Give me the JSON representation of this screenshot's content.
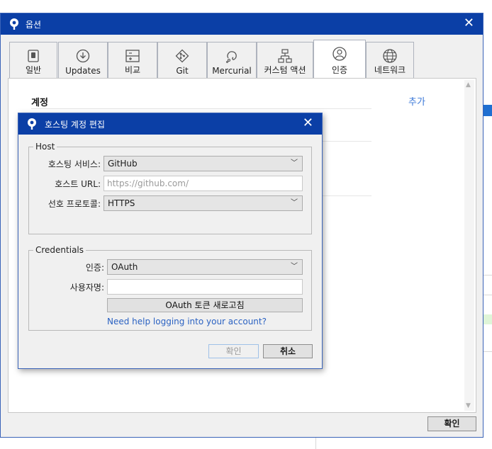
{
  "options_window": {
    "title": "옵션",
    "close_glyph": "✕",
    "tabs": [
      {
        "label": "일반",
        "icon": "switch-icon"
      },
      {
        "label": "Updates",
        "icon": "download-icon"
      },
      {
        "label": "비교",
        "icon": "diff-icon"
      },
      {
        "label": "Git",
        "icon": "git-icon"
      },
      {
        "label": "Mercurial",
        "icon": "mercurial-icon"
      },
      {
        "label": "커스텀 액션",
        "icon": "custom-action-icon"
      },
      {
        "label": "인증",
        "icon": "user-icon"
      },
      {
        "label": "네트워크",
        "icon": "globe-icon"
      }
    ],
    "active_tab": "인증",
    "accounts_heading": "계정",
    "add_link": "추가",
    "ok_button": "확인"
  },
  "dialog": {
    "title": "호스팅 계정 편집",
    "close_glyph": "✕",
    "host_group": {
      "legend": "Host",
      "hosting_service_label": "호스팅 서비스:",
      "hosting_service_value": "GitHub",
      "host_url_label": "호스트 URL:",
      "host_url_placeholder": "https://github.com/",
      "protocol_label": "선호 프로토콜:",
      "protocol_value": "HTTPS"
    },
    "credentials_group": {
      "legend": "Credentials",
      "auth_label": "인증:",
      "auth_value": "OAuth",
      "username_label": "사용자명:",
      "username_value": "",
      "refresh_button": "OAuth 토큰 새로고침",
      "help_link": "Need help logging into your account?"
    },
    "ok_button": "확인",
    "cancel_button": "취소"
  },
  "colors": {
    "titlebar": "#0b3fa6",
    "link": "#3b78d8",
    "disabled_border": "#9fc1e8"
  }
}
